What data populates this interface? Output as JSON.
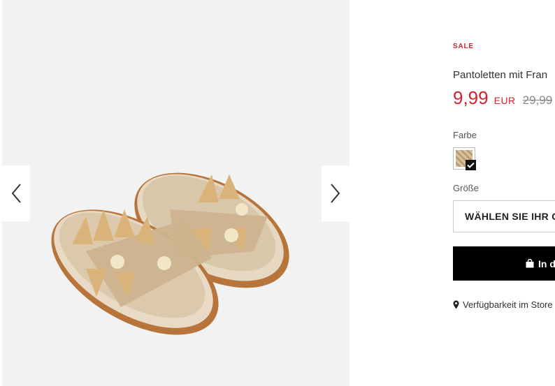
{
  "gallery": {
    "prev_icon": "chevron-left-icon",
    "next_icon": "chevron-right-icon",
    "image_alt": "product-image"
  },
  "product": {
    "badge": "SALE",
    "title": "Pantoletten mit Fran",
    "price": "9,99",
    "currency": "EUR",
    "old_price": "29,99"
  },
  "color": {
    "label": "Farbe",
    "selected_swatch": "beige-raffia"
  },
  "size": {
    "label": "Größe",
    "placeholder": "WÄHLEN SIE IHR G"
  },
  "cart": {
    "label": "In d",
    "icon": "shopping-bag-icon"
  },
  "availability": {
    "label": "Verfügbarkeit im Store",
    "icon": "map-pin-icon"
  },
  "colors": {
    "sale_red": "#d0232f",
    "button_black": "#000000",
    "gallery_bg": "#f2f2f2"
  }
}
